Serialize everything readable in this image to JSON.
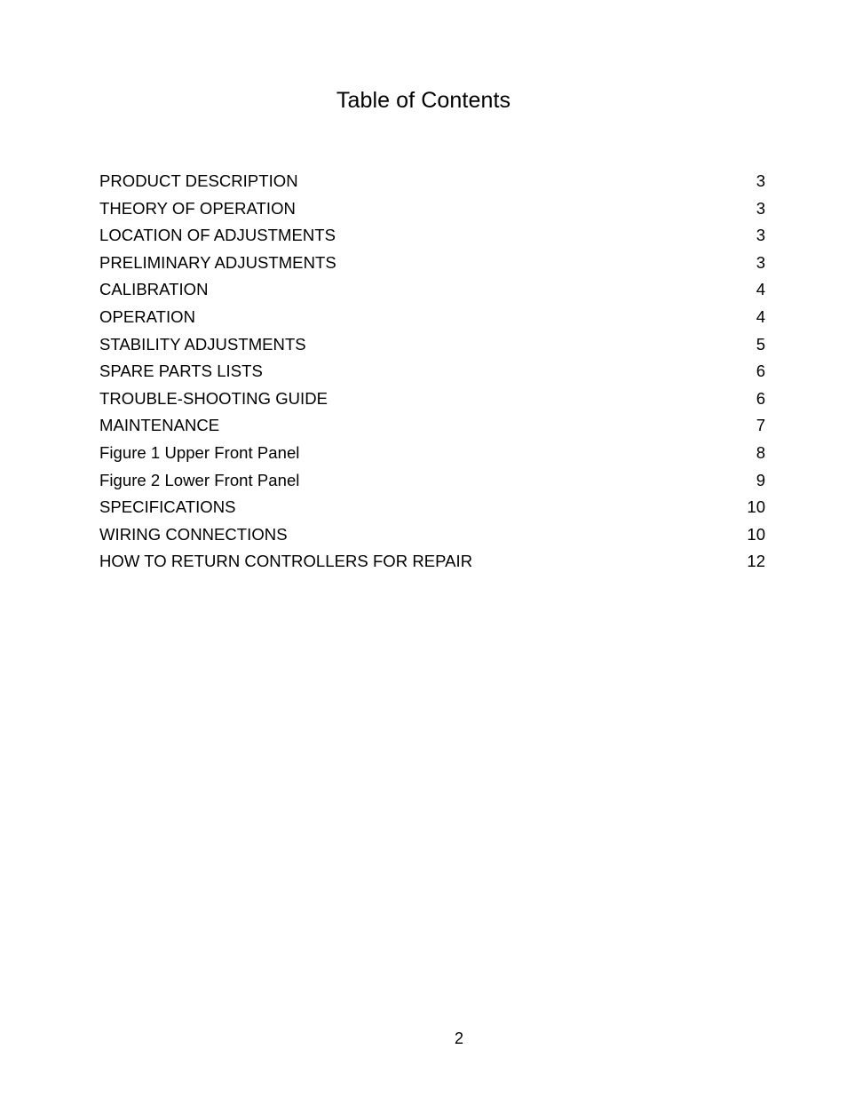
{
  "document": {
    "title": "Table of Contents",
    "footer_page_number": "2"
  },
  "toc": {
    "entries": [
      {
        "label": "PRODUCT DESCRIPTION",
        "page": "3"
      },
      {
        "label": "THEORY OF OPERATION",
        "page": "3"
      },
      {
        "label": "LOCATION OF ADJUSTMENTS",
        "page": "3"
      },
      {
        "label": "PRELIMINARY ADJUSTMENTS",
        "page": "3"
      },
      {
        "label": "CALIBRATION",
        "page": "4"
      },
      {
        "label": "OPERATION",
        "page": "4"
      },
      {
        "label": "STABILITY ADJUSTMENTS",
        "page": "5"
      },
      {
        "label": "SPARE PARTS LISTS",
        "page": "6"
      },
      {
        "label": "TROUBLE-SHOOTING GUIDE",
        "page": "6"
      },
      {
        "label": "MAINTENANCE",
        "page": "7"
      },
      {
        "label": "Figure 1 Upper Front Panel",
        "page": "8"
      },
      {
        "label": "Figure 2 Lower Front Panel",
        "page": "9"
      },
      {
        "label": "SPECIFICATIONS",
        "page": "10"
      },
      {
        "label": "WIRING CONNECTIONS",
        "page": "10"
      },
      {
        "label": "HOW TO RETURN CONTROLLERS FOR REPAIR",
        "page": "12"
      }
    ]
  }
}
